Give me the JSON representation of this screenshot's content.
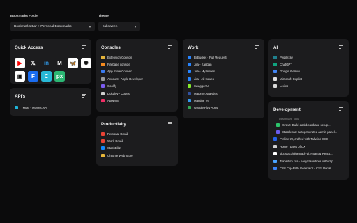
{
  "controls": {
    "folder_label": "Bookmarks Folder",
    "folder_value": "Bookmarks Bar > Personal Bookmarks",
    "theme_label": "Theme",
    "theme_value": "Halloween"
  },
  "quick_access": {
    "title": "Quick Access",
    "icons": [
      {
        "name": "youtube-icon",
        "glyph": "▶",
        "bg": "#ffffff",
        "fg": "#ff0000"
      },
      {
        "name": "x-icon",
        "glyph": "𝕏",
        "bg": "#1c1c1e",
        "fg": "#ffffff"
      },
      {
        "name": "linkedin-icon",
        "glyph": "in",
        "bg": "#1c1c1e",
        "fg": "#2f8fd8"
      },
      {
        "name": "gmail-icon",
        "glyph": "M",
        "bg": "#1c1c1e",
        "fg": "#f2f2f2"
      },
      {
        "name": "bluesky-icon",
        "glyph": "🦋",
        "bg": "#ffffff",
        "fg": "#1a7cf5"
      },
      {
        "name": "openai-icon",
        "glyph": "✺",
        "bg": "#ffffff",
        "fg": "#111111"
      },
      {
        "name": "notion-icon",
        "glyph": "▣",
        "bg": "#ffffff",
        "fg": "#111111"
      },
      {
        "name": "framer-icon",
        "glyph": "F",
        "bg": "#1a6cf0",
        "fg": "#ffffff"
      },
      {
        "name": "canva-icon",
        "glyph": "C",
        "bg": "#28b8d6",
        "fg": "#ffffff"
      },
      {
        "name": "pixel-icon",
        "glyph": "px",
        "bg": "#2bb673",
        "fg": "#ffffff"
      }
    ]
  },
  "apis": {
    "title": "API's",
    "items": [
      {
        "label": "TMDB - Movies API",
        "icon": "tmdb-icon",
        "color": "#1fb4d8"
      }
    ]
  },
  "consoles": {
    "title": "Consoles",
    "items": [
      {
        "label": "Extension Console",
        "icon": "chrome-icon",
        "color": "#e2b23a"
      },
      {
        "label": "Firebase console",
        "icon": "firebase-icon",
        "color": "#f58a1f"
      },
      {
        "label": "App Store Connect",
        "icon": "appstore-icon",
        "color": "#3a7bf0"
      },
      {
        "label": "Account - Apple Developer",
        "icon": "apple-icon",
        "color": "#9a9a9a"
      },
      {
        "label": "Coolify",
        "icon": "coolify-icon",
        "color": "#7b5cf0"
      },
      {
        "label": "Dokploy - Codes",
        "icon": "dokploy-icon",
        "color": "#cfcfcf"
      },
      {
        "label": "Appwrite",
        "icon": "appwrite-icon",
        "color": "#f02e65"
      }
    ]
  },
  "productivity": {
    "title": "Productivity",
    "items": [
      {
        "label": "Personal Gmail",
        "icon": "gmail-icon",
        "color": "#ea4335"
      },
      {
        "label": "Work Gmail",
        "icon": "gmail-icon",
        "color": "#ea4335"
      },
      {
        "label": "StackBlitz",
        "icon": "stackblitz-icon",
        "color": "#1389fd"
      },
      {
        "label": "Chrome Web Store",
        "icon": "chrome-store-icon",
        "color": "#e9b83a"
      }
    ]
  },
  "work": {
    "title": "Work",
    "items": [
      {
        "label": "BitBucket - Pull Requests",
        "icon": "bitbucket-icon",
        "color": "#2684ff"
      },
      {
        "label": "Jira - Kanban",
        "icon": "jira-icon",
        "color": "#2684ff"
      },
      {
        "label": "Jira - My Issues",
        "icon": "jira-icon",
        "color": "#2684ff"
      },
      {
        "label": "Jira - All Issues",
        "icon": "jira-icon",
        "color": "#2684ff"
      },
      {
        "label": "Swagger UI",
        "icon": "swagger-icon",
        "color": "#85ea2d"
      },
      {
        "label": "Matomo Analytics",
        "icon": "matomo-icon",
        "color": "#3152a0"
      },
      {
        "label": "Mantine V6",
        "icon": "mantine-icon",
        "color": "#339af0"
      },
      {
        "label": "Google Play Apps",
        "icon": "google-play-icon",
        "color": "#34a853"
      }
    ]
  },
  "ai": {
    "title": "AI",
    "items": [
      {
        "label": "Perplexity",
        "icon": "perplexity-icon",
        "color": "#20808d"
      },
      {
        "label": "ChatGPT",
        "icon": "chatgpt-icon",
        "color": "#10a37f"
      },
      {
        "label": "Google Gemini",
        "icon": "gemini-icon",
        "color": "#4285f4"
      },
      {
        "label": "Microsoft Copilot",
        "icon": "copilot-icon",
        "color": "#e0e0e0"
      },
      {
        "label": "Lexica",
        "icon": "lexica-icon",
        "color": "#d8d8d8"
      }
    ]
  },
  "development": {
    "title": "Development",
    "sublabel": "Dashboard Tools",
    "nested": [
      {
        "label": "Gravit: Build dashboard and setup...",
        "icon": "gravit-icon",
        "color": "#2cc46b"
      },
      {
        "label": "Statelessa: autogenerated admin panel...",
        "icon": "statelessa-icon",
        "color": "#6a5cf0"
      }
    ],
    "items": [
      {
        "label": "Preline UI, crafted with Tailwind CSS",
        "icon": "preline-icon",
        "color": "#2563eb"
      },
      {
        "label": "Home | Laws of UX",
        "icon": "laws-of-ux-icon",
        "color": "#d0d0d0"
      },
      {
        "label": "glucstack/gluestack-ui: React & React...",
        "icon": "github-icon",
        "color": "#ffffff"
      },
      {
        "label": "Transition.css - easy transitions with clip...",
        "icon": "transition-icon",
        "color": "#4aa3ff"
      },
      {
        "label": "CSS Clip-Path Generator - CSS Portal",
        "icon": "cssportal-icon",
        "color": "#3b82f6"
      }
    ]
  }
}
